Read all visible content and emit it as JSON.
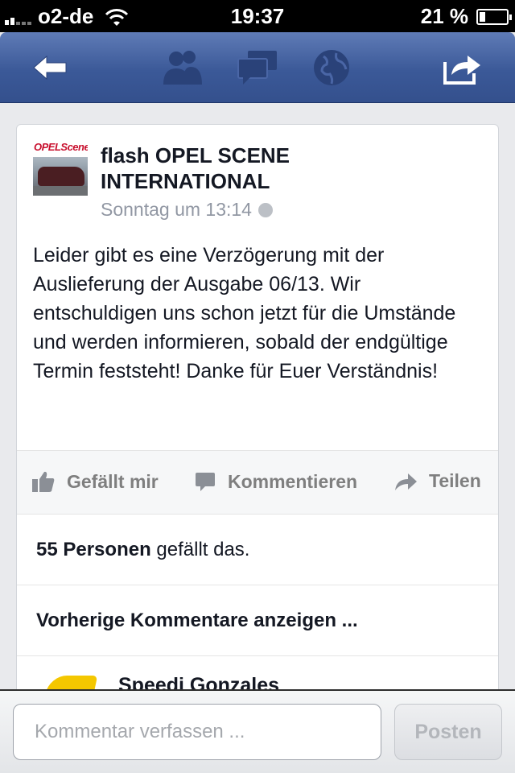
{
  "status_bar": {
    "carrier": "o2-de",
    "time": "19:37",
    "battery_text": "21 %",
    "battery_level": 0.21
  },
  "nav": {
    "back_icon": "back-arrow-icon",
    "friends_icon": "friends-icon",
    "messages_icon": "messages-icon",
    "notifications_icon": "globe-icon",
    "share_icon": "share-icon",
    "color": "#3b5998"
  },
  "post": {
    "page_name": "flash OPEL SCENE INTERNATIONAL",
    "thumb_logo": "OPELScene",
    "timestamp": "Sonntag um 13:14",
    "text": "Leider gibt es eine Verzögerung mit der Auslieferung der Ausgabe 06/13. Wir entschuldigen uns schon jetzt für die Umstände und werden informieren, sobald der endgültige Termin feststeht! Danke für Euer Verständnis!"
  },
  "actions": {
    "like": "Gefällt mir",
    "comment": "Kommentieren",
    "share": "Teilen"
  },
  "likes": {
    "count_text": "55 Personen",
    "suffix": " gefällt das."
  },
  "previous_comments": "Vorherige Kommentare anzeigen ...",
  "comment": {
    "author": "Speedi Gonzales"
  },
  "composer": {
    "placeholder": "Kommentar verfassen ...",
    "post_label": "Posten"
  }
}
